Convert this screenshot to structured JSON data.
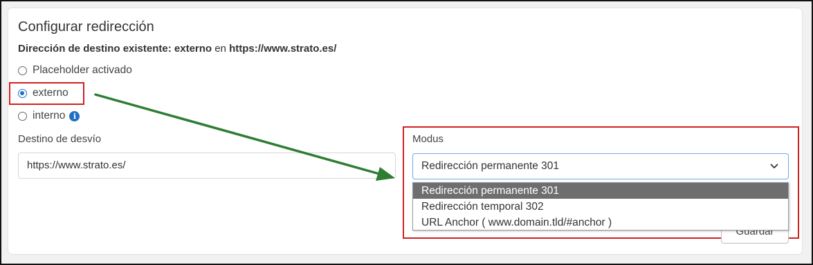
{
  "title": "Configurar redirección",
  "subtitle": {
    "bold_prefix": "Dirección de destino existente: externo",
    "connector": "en",
    "bold_url": "https://www.strato.es/"
  },
  "radio_options": [
    {
      "label": "Placeholder activado",
      "checked": false
    },
    {
      "label": "externo",
      "checked": true
    },
    {
      "label": "interno",
      "checked": false
    }
  ],
  "info_icon_glyph": "i",
  "destination": {
    "label": "Destino de desvío",
    "value": "https://www.strato.es/"
  },
  "modus": {
    "label": "Modus",
    "selected": "Redirección permanente 301",
    "options": [
      "Redirección permanente 301",
      "Redirección temporal 302",
      "URL Anchor ( www.domain.tld/#anchor )"
    ]
  },
  "save_label": "Guardar",
  "colors": {
    "accent": "#1f6fc4",
    "highlight_box": "#d02020",
    "annotation_arrow": "#2e7d32",
    "selected_option_bg": "#6e6e6e"
  }
}
